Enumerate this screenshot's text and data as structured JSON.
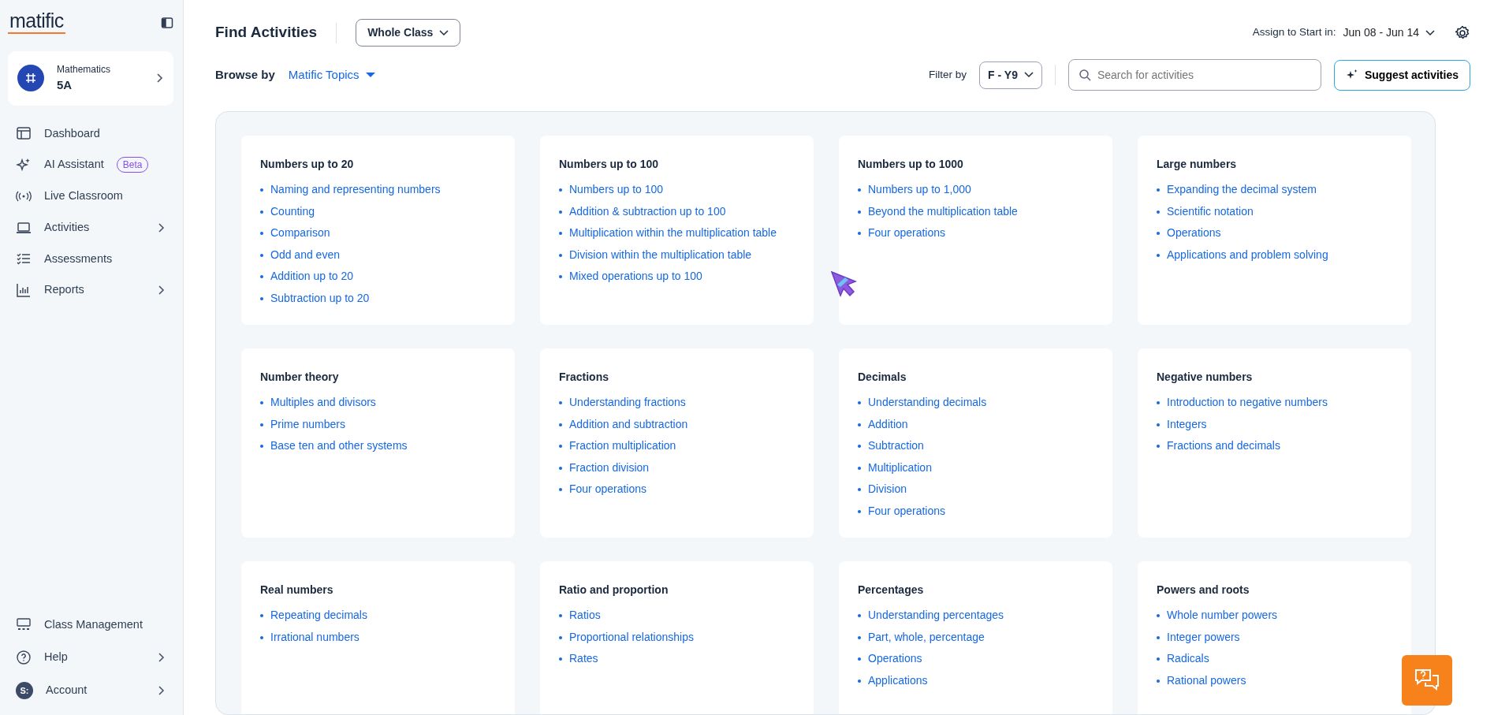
{
  "sidebar": {
    "logo": "matific",
    "class_card": {
      "subject": "Mathematics",
      "name": "5A"
    },
    "nav": [
      {
        "label": "Dashboard",
        "submenu": false
      },
      {
        "label": "AI Assistant",
        "badge": "Beta",
        "submenu": false
      },
      {
        "label": "Live Classroom",
        "submenu": false
      },
      {
        "label": "Activities",
        "submenu": true
      },
      {
        "label": "Assessments",
        "submenu": false
      },
      {
        "label": "Reports",
        "submenu": true
      }
    ],
    "bottom_nav": [
      {
        "label": "Class Management",
        "submenu": false
      },
      {
        "label": "Help",
        "submenu": true
      },
      {
        "label": "Account",
        "avatar": "S:",
        "submenu": true
      }
    ]
  },
  "header": {
    "title": "Find Activities",
    "audience": "Whole Class",
    "assign_label": "Assign to Start in:",
    "date_range": "Jun 08 - Jun 14",
    "browse_label": "Browse by",
    "browse_value": "Matific Topics",
    "filter_label": "Filter by",
    "filter_value": "F - Y9",
    "search": {
      "placeholder": "Search for activities"
    },
    "suggest_button": "Suggest activities"
  },
  "topics": [
    {
      "title": "Numbers up to 20",
      "items": [
        "Naming and representing numbers",
        "Counting",
        "Comparison",
        "Odd and even",
        "Addition up to 20",
        "Subtraction up to 20"
      ]
    },
    {
      "title": "Numbers up to 100",
      "items": [
        "Numbers up to 100",
        "Addition & subtraction up to 100",
        "Multiplication within the multiplication table",
        "Division within the multiplication table",
        "Mixed operations up to 100"
      ]
    },
    {
      "title": "Numbers up to 1000",
      "items": [
        "Numbers up to 1,000",
        "Beyond the multiplication table",
        "Four operations"
      ]
    },
    {
      "title": "Large numbers",
      "items": [
        "Expanding the decimal system",
        "Scientific notation",
        "Operations",
        "Applications and problem solving"
      ]
    },
    {
      "title": "Number theory",
      "items": [
        "Multiples and divisors",
        "Prime numbers",
        "Base ten and other systems"
      ]
    },
    {
      "title": "Fractions",
      "items": [
        "Understanding fractions",
        "Addition and subtraction",
        "Fraction multiplication",
        "Fraction division",
        "Four operations"
      ]
    },
    {
      "title": "Decimals",
      "items": [
        "Understanding decimals",
        "Addition",
        "Subtraction",
        "Multiplication",
        "Division",
        "Four operations"
      ]
    },
    {
      "title": "Negative numbers",
      "items": [
        "Introduction to negative numbers",
        "Integers",
        "Fractions and decimals"
      ]
    },
    {
      "title": "Real numbers",
      "items": [
        "Repeating decimals",
        "Irrational numbers"
      ]
    },
    {
      "title": "Ratio and proportion",
      "items": [
        "Ratios",
        "Proportional relationships",
        "Rates"
      ]
    },
    {
      "title": "Percentages",
      "items": [
        "Understanding percentages",
        "Part, whole, percentage",
        "Operations",
        "Applications"
      ]
    },
    {
      "title": "Powers and roots",
      "items": [
        "Whole number powers",
        "Integer powers",
        "Radicals",
        "Rational powers"
      ]
    }
  ]
}
